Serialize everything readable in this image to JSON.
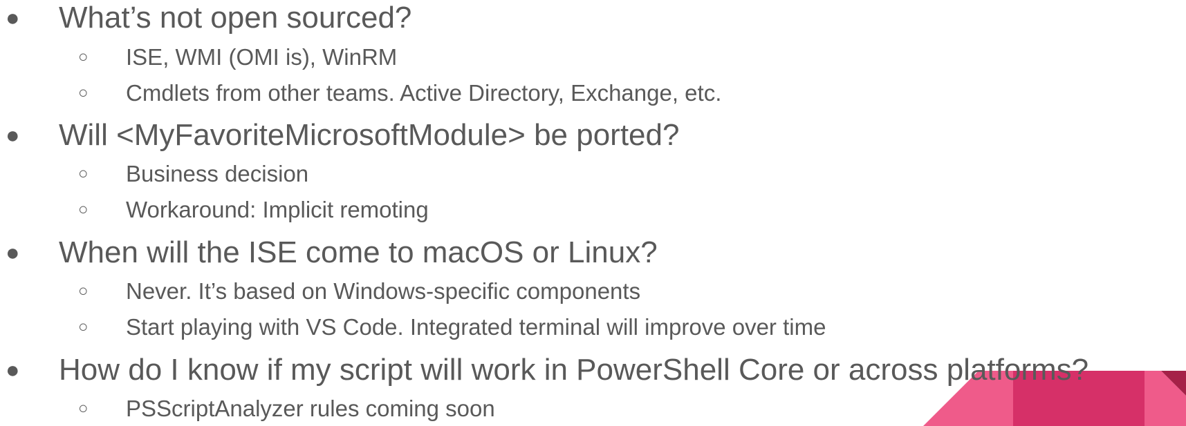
{
  "bullets": [
    {
      "text": "What’s not open sourced?",
      "children": [
        "ISE, WMI (OMI is), WinRM",
        "Cmdlets from other teams.  Active Directory, Exchange, etc."
      ]
    },
    {
      "text": "Will <MyFavoriteMicrosoftModule> be ported?",
      "children": [
        "Business decision",
        "Workaround: Implicit remoting"
      ]
    },
    {
      "text": "When will the ISE come to macOS or Linux?",
      "children": [
        "Never.  It’s based on Windows-specific components",
        "Start playing with VS Code.  Integrated terminal will improve over time"
      ]
    },
    {
      "text": "How do I know if my script will work in PowerShell Core or across platforms?",
      "children": [
        "PSScriptAnalyzer rules coming soon"
      ]
    }
  ],
  "symbols": {
    "bullet_filled": "●",
    "bullet_hollow": "○"
  },
  "colors": {
    "text": "#595959",
    "deco_light": "#ef5b8a",
    "deco_mid": "#d63068",
    "deco_dark": "#a52148"
  }
}
